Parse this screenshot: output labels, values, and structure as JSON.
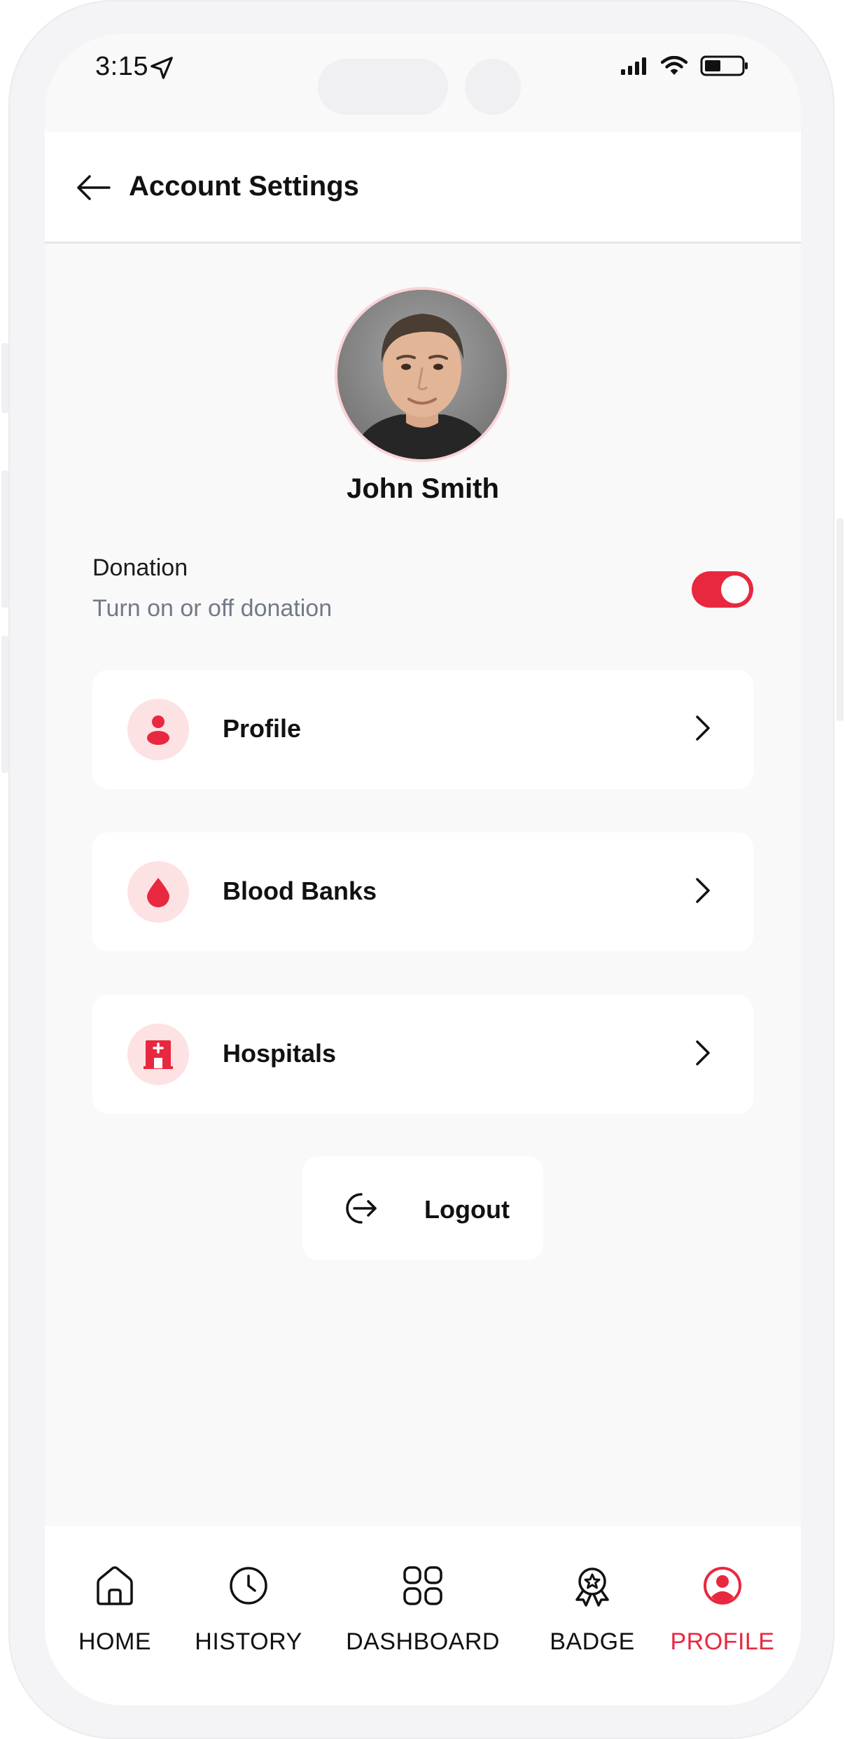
{
  "status_bar": {
    "time": "3:15"
  },
  "header": {
    "title": "Account Settings"
  },
  "user": {
    "name": "John Smith"
  },
  "donation": {
    "title": "Donation",
    "subtitle": "Turn on or off donation",
    "enabled": true
  },
  "menu": {
    "items": [
      {
        "label": "Profile",
        "icon": "person-icon"
      },
      {
        "label": "Blood Banks",
        "icon": "blood-drop-icon"
      },
      {
        "label": "Hospitals",
        "icon": "hospital-icon"
      }
    ]
  },
  "logout": {
    "label": "Logout"
  },
  "nav": {
    "items": [
      {
        "label": "HOME",
        "icon": "home-icon"
      },
      {
        "label": "HISTORY",
        "icon": "clock-icon"
      },
      {
        "label": "DASHBOARD",
        "icon": "grid-icon"
      },
      {
        "label": "BADGE",
        "icon": "badge-icon"
      },
      {
        "label": "PROFILE",
        "icon": "profile-icon",
        "active": true
      }
    ]
  },
  "colors": {
    "accent": "#e8283f",
    "accent_soft": "#fde2e4",
    "background": "#f9f9fa",
    "card": "#ffffff",
    "muted_text": "#737a86"
  }
}
